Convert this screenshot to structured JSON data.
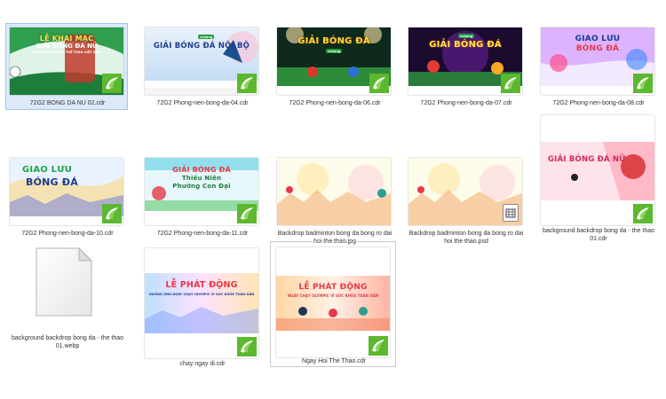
{
  "colors": {
    "selection_bg": "#dbe9f8",
    "selection_border": "#9ec6ee",
    "cdr_green": "#5cb82e"
  },
  "files": [
    {
      "name": "72G2 BONG DA NU 02.cdr",
      "thumb": {
        "line1": "LỄ KHAI MẠC",
        "line2": "GIẢI BÓNG ĐÁ NỮ",
        "line3": "HƯỞNG ỨNG NGÀY THỂ THAO VIỆT NAM"
      },
      "badge": "cdr-icon"
    },
    {
      "name": "72G2 Phong-nen-bong-da-04.cdr",
      "thumb": {
        "brand": "ovhang",
        "line1": "GIẢI BÓNG ĐÁ NỘI BỘ"
      },
      "badge": "cdr-icon"
    },
    {
      "name": "72G2 Phong-nen-bong-da-06.cdr",
      "thumb": {
        "line1": "GIẢI BÓNG ĐÁ",
        "brand": "ovhang"
      },
      "badge": "cdr-icon"
    },
    {
      "name": "72G2 Phong-nen-bong-da-07.cdr",
      "thumb": {
        "brand": "ovhang",
        "line1": "GIẢI BÓNG ĐÁ"
      },
      "badge": "cdr-icon"
    },
    {
      "name": "72G2 Phong-nen-bong-da-08.cdr",
      "thumb": {
        "line1": "GIAO LƯU",
        "line2": "BÓNG ĐÁ"
      },
      "badge": "cdr-icon"
    },
    {
      "name": "72G2 Phong-nen-bong-da-10.cdr",
      "thumb": {
        "line1": "GIAO LƯU",
        "line2": "BÓNG ĐÁ"
      },
      "badge": "cdr-icon"
    },
    {
      "name": "72G2 Phong-nen-bong-da-11.cdr",
      "thumb": {
        "line1": "GIẢI BÓNG ĐÁ",
        "line2": "Thiếu Niên",
        "line3": "Phường Con Đại"
      },
      "badge": "cdr-icon"
    },
    {
      "name": "Backdrop badminton bong da bong ro dai hoi the thao.jpg",
      "thumb": {},
      "badge": ""
    },
    {
      "name": "Backdrop badminton bong da bong ro dai hoi the thao.psd",
      "thumb": {},
      "badge": "psd-icon"
    },
    {
      "name": "background backdrop bong da - the thao 01.cdr",
      "thumb": {
        "line1": "GIẢI BÓNG ĐÁ NỮ"
      },
      "badge": "cdr-icon"
    },
    {
      "name": "background backdrop bong da - the thao 01.webp",
      "thumb": {},
      "badge": "document-icon"
    },
    {
      "name": "chay ngay di.cdr",
      "thumb": {
        "line1": "LỄ PHÁT ĐỘNG",
        "line2": "HƯỞNG ỨNG NGÀY CHẠY OLYMPIC VÌ SỨC KHỎE TOÀN DÂN"
      },
      "badge": "cdr-icon"
    },
    {
      "name": "Ngay Hoi The Thao.cdr",
      "thumb": {
        "line1": "LỄ PHÁT ĐỘNG",
        "line2": "NGÀY CHẠY OLYMPIC VÌ SỨC KHỎE TOÀN DÂN"
      },
      "badge": "cdr-icon"
    }
  ]
}
